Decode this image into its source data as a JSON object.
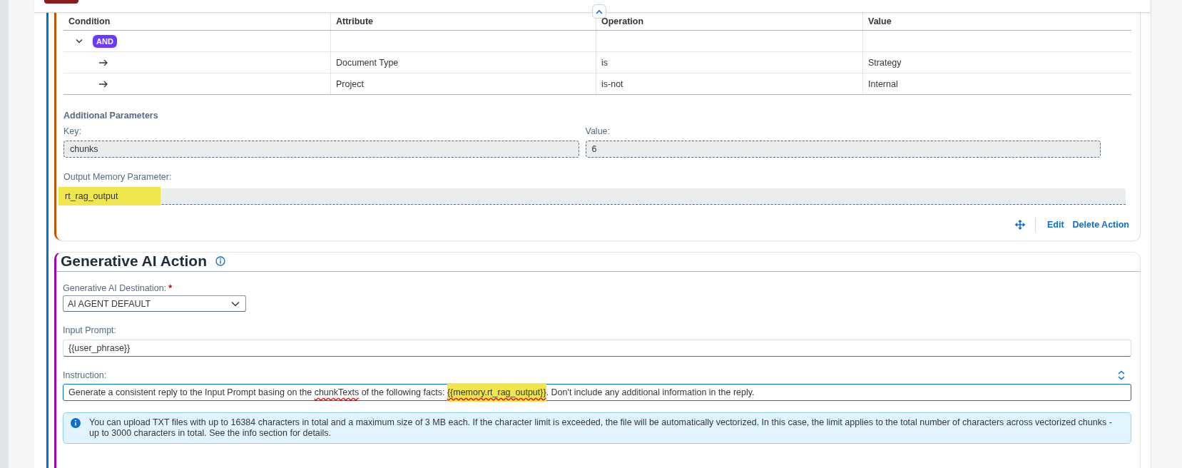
{
  "conditions_table": {
    "columns": [
      "Condition",
      "Attribute",
      "Operation",
      "Value"
    ],
    "rows": [
      {
        "kind": "group",
        "expanded": true,
        "badge": "AND"
      },
      {
        "kind": "condition",
        "attribute": "Document Type",
        "operation": "is",
        "value": "Strategy"
      },
      {
        "kind": "condition",
        "attribute": "Project",
        "operation": "is-not",
        "value": "Internal"
      }
    ]
  },
  "additional_parameters": {
    "title": "Additional Parameters",
    "key_label": "Key:",
    "key_value": "chunks",
    "value_label": "Value:",
    "value_value": "6"
  },
  "output_memory": {
    "label": "Output Memory Parameter:",
    "value": "rt_rag_output",
    "highlighted": true
  },
  "actions": [
    {
      "kind": "move"
    },
    {
      "kind": "link",
      "label": "Edit"
    },
    {
      "kind": "link",
      "label": "Delete Action"
    }
  ],
  "generative_ai_action": {
    "title": "Generative AI Action",
    "destination": {
      "label": "Generative AI Destination:",
      "required_mark": "*",
      "value": "AI AGENT DEFAULT"
    },
    "input_prompt": {
      "label": "Input Prompt:",
      "value": "{{user_phrase}}"
    },
    "instruction": {
      "label": "Instruction:",
      "segments": [
        {
          "text": "Generate a consistent reply to the Input Prompt basing on the ",
          "highlighted": false,
          "misspelled": false
        },
        {
          "text": "chunkTexts",
          "highlighted": false,
          "misspelled": true
        },
        {
          "text": " of the following facts: ",
          "highlighted": false,
          "misspelled": false
        },
        {
          "text": "{{memory.rt_rag_output}}",
          "highlighted": true,
          "misspelled": true
        },
        {
          "text": ". Don't include any additional information in the reply.",
          "highlighted": false,
          "misspelled": false
        }
      ]
    },
    "info_message": "You can upload TXT files with up to 16384 characters in total and a maximum size of 3 MB each. If the character limit is exceeded, the file will be automatically vectorized. In this case, the limit applies to the total number of characters across vectorized chunks - up to 3000 characters in total. See the info section for details."
  }
}
